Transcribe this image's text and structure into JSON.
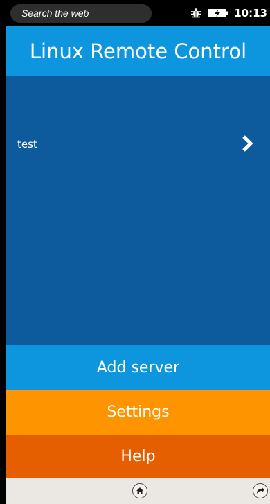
{
  "status_bar": {
    "search_placeholder": "Search the web",
    "time": "10:13",
    "icons": [
      "bug-icon",
      "battery-charging-icon"
    ]
  },
  "header": {
    "title": "Linux Remote Control"
  },
  "servers": [
    {
      "label": "test",
      "icon": "chevron-right-icon"
    }
  ],
  "buttons": {
    "add_server": "Add server",
    "settings": "Settings",
    "help": "Help"
  },
  "nav_bar": {
    "icons": [
      "home-icon",
      "refresh-icon"
    ]
  },
  "colors": {
    "header_blue": "#0d96dd",
    "list_blue": "#0d5a9c",
    "settings_orange": "#fe9400",
    "help_orange": "#e55e00",
    "nav_gray": "#ebe8e4"
  }
}
